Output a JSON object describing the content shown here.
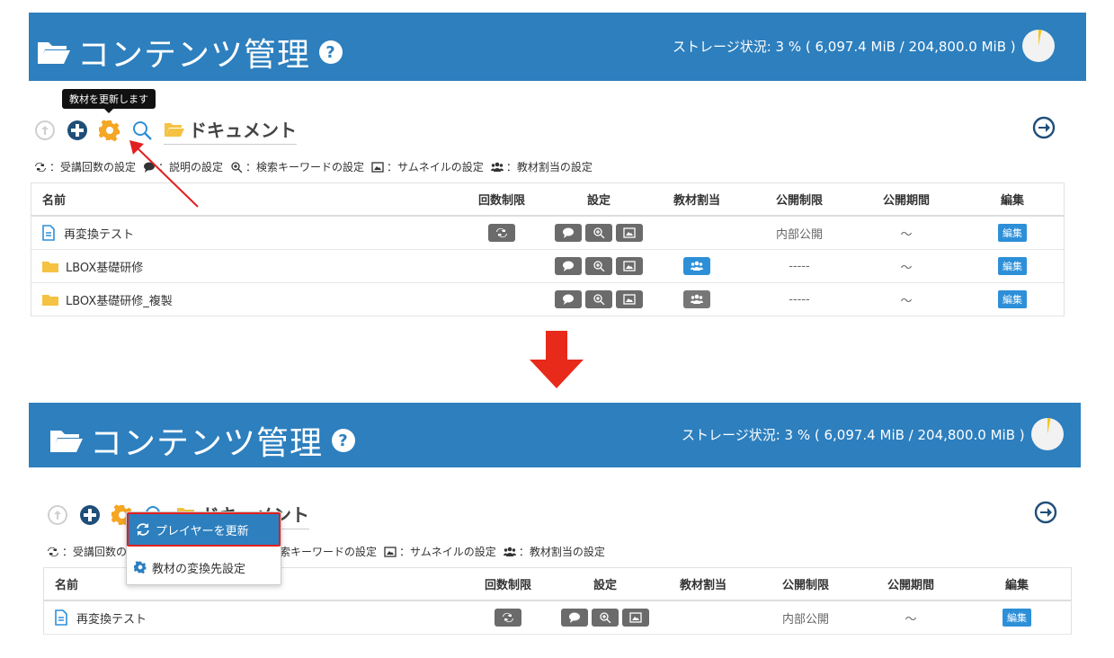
{
  "header": {
    "title": "コンテンツ管理",
    "help": "?",
    "storage_label": "ストレージ状況: 3 % ( 6,097.4 MiB / 204,800.0 MiB )",
    "storage_percent": 3
  },
  "toolbar": {
    "tooltip": "教材を更新します",
    "folder_name": "ドキュメント"
  },
  "legend": [
    {
      "icon": "repeat-icon",
      "text": "：受講回数の設定"
    },
    {
      "icon": "comment-icon",
      "text": "：説明の設定"
    },
    {
      "icon": "zoom-in-icon",
      "text": "：検索キーワードの設定"
    },
    {
      "icon": "image-icon",
      "text": "：サムネイルの設定"
    },
    {
      "icon": "users-icon",
      "text": "：教材割当の設定"
    }
  ],
  "table": {
    "headers": [
      "名前",
      "回数制限",
      "設定",
      "教材割当",
      "公開制限",
      "公開期間",
      "編集"
    ],
    "rows": [
      {
        "type": "document",
        "name": "再変換テスト",
        "repeat": true,
        "assign": false,
        "public": "内部公開",
        "period": "～",
        "edit": "編集"
      },
      {
        "type": "folder",
        "name": "LBOX基礎研修",
        "repeat": false,
        "assign": true,
        "assign_active": true,
        "public": "-----",
        "period": "～",
        "edit": "編集"
      },
      {
        "type": "folder",
        "name": "LBOX基礎研修_複製",
        "repeat": false,
        "assign": true,
        "assign_active": false,
        "public": "-----",
        "period": "～",
        "edit": "編集"
      }
    ]
  },
  "dropdown": {
    "items": [
      {
        "icon": "refresh-icon",
        "label": "プレイヤーを更新",
        "highlighted": true
      },
      {
        "icon": "gear-icon",
        "label": "教材の変換先設定",
        "highlighted": false
      }
    ]
  },
  "colors": {
    "header": "#2d7fbe",
    "accent_orange": "#f5a623",
    "button_blue": "#2d8fd8",
    "annotation_red": "#e02020"
  }
}
